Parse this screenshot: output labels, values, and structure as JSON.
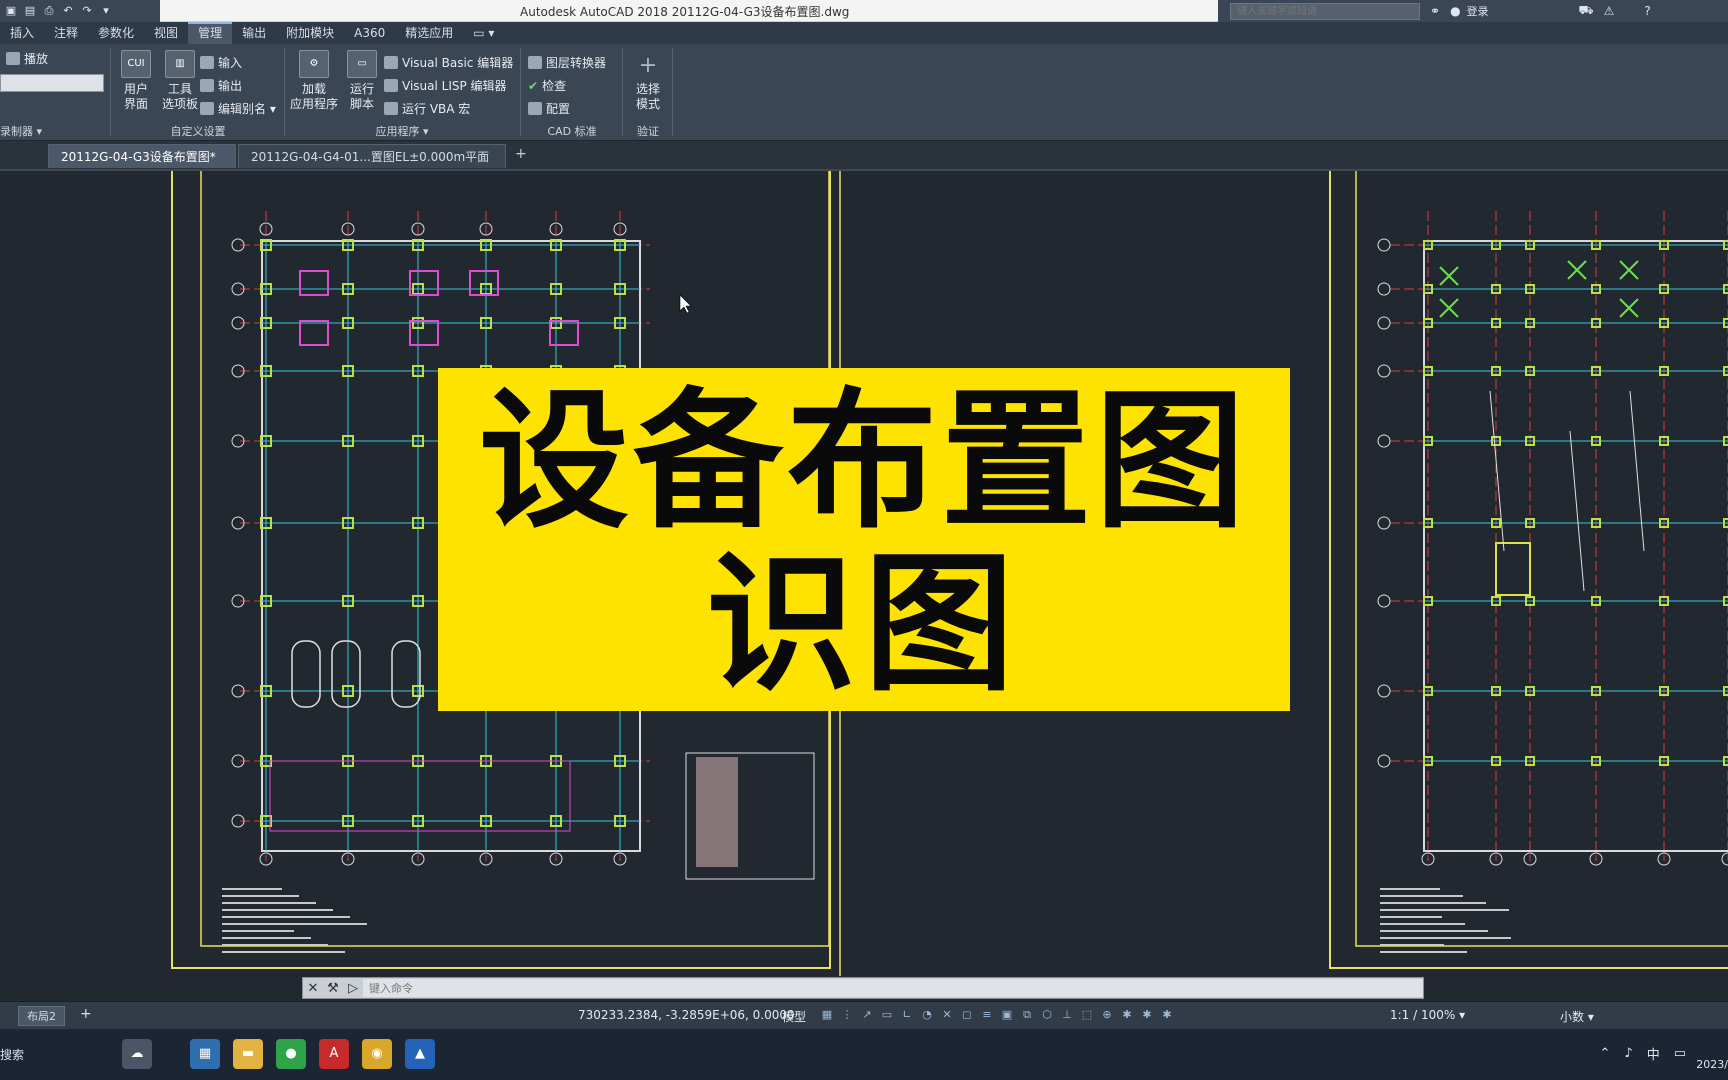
{
  "titlebar": {
    "title": "Autodesk AutoCAD 2018    20112G-04-G3设备布置图.dwg",
    "search_placeholder": "键入关键字或短语",
    "login": "登录"
  },
  "ribbon_tabs": [
    "插入",
    "注释",
    "参数化",
    "视图",
    "管理",
    "输出",
    "附加模块",
    "A360",
    "精选应用"
  ],
  "ribbon": {
    "left_small": [
      "播放",
      "录制器"
    ],
    "customize": {
      "user_interface": "用户\n界面",
      "tool_palettes": "工具\n选项板",
      "import": "输入",
      "export": "输出",
      "edit_aliases": "编辑别名",
      "panel_label": "自定义设置"
    },
    "apps": {
      "load_app": "加载\n应用程序",
      "run_script": "运行\n脚本",
      "vb_editor": "Visual Basic 编辑器",
      "lisp_editor": "Visual LISP 编辑器",
      "run_vba": "运行 VBA 宏",
      "panel_label": "应用程序"
    },
    "cad_standards": {
      "layer_translator": "图层转换器",
      "check": "检查",
      "configure": "配置",
      "panel_label": "CAD 标准"
    },
    "select_mode": {
      "label": "选择\n模式",
      "panel_label": "验证"
    }
  },
  "file_tabs": [
    {
      "label": "20112G-04-G3设备布置图*",
      "active": true
    },
    {
      "label": "20112G-04-G4-01...置图EL±0.000m平面*",
      "active": false
    }
  ],
  "banner": {
    "line1": "设备布置图",
    "line2": "识图",
    "color": "#ffe300"
  },
  "command": {
    "placeholder": "键入命令"
  },
  "statusbar": {
    "layout_tab": "布局2",
    "coords": "730233.2384, -3.2859E+06, 0.0000",
    "model": "模型",
    "scale": "1:1 / 100%",
    "units": "小数"
  },
  "taskbar": {
    "search": "搜索",
    "tray_lang": "中",
    "clock": "2023/"
  }
}
